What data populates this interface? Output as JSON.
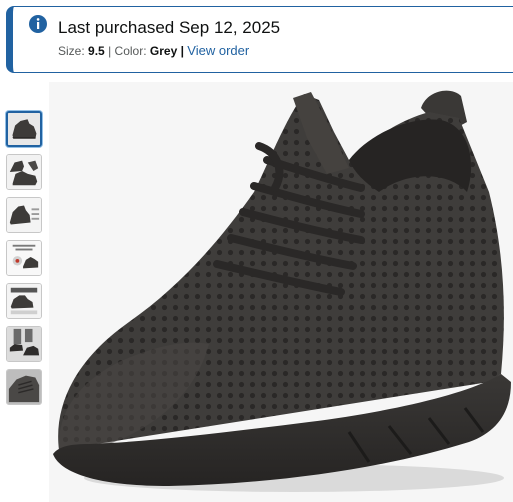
{
  "banner": {
    "icon": "info-icon",
    "title": "Last purchased Sep 12, 2025",
    "size_label": "Size:",
    "size_value": "9.5",
    "separator": "|",
    "color_label": "Color:",
    "color_value": "Grey",
    "view_order_link": "View order",
    "accent_color": "#2162a1"
  },
  "gallery": {
    "thumbnails": [
      {
        "icon": "shoe-side-thumbnail",
        "selected": true
      },
      {
        "icon": "shoe-pair-thumbnail",
        "selected": false
      },
      {
        "icon": "shoe-features-thumbnail",
        "selected": false
      },
      {
        "icon": "shoe-lightweight-thumbnail",
        "selected": false
      },
      {
        "icon": "shoe-size-chart-thumbnail",
        "selected": false
      },
      {
        "icon": "shoe-lifestyle-thumbnail",
        "selected": false
      },
      {
        "icon": "shoe-closeup-thumbnail",
        "selected": false
      }
    ],
    "main_image": {
      "icon": "grey-knit-sneaker-image",
      "color": "#3d3b39"
    }
  }
}
